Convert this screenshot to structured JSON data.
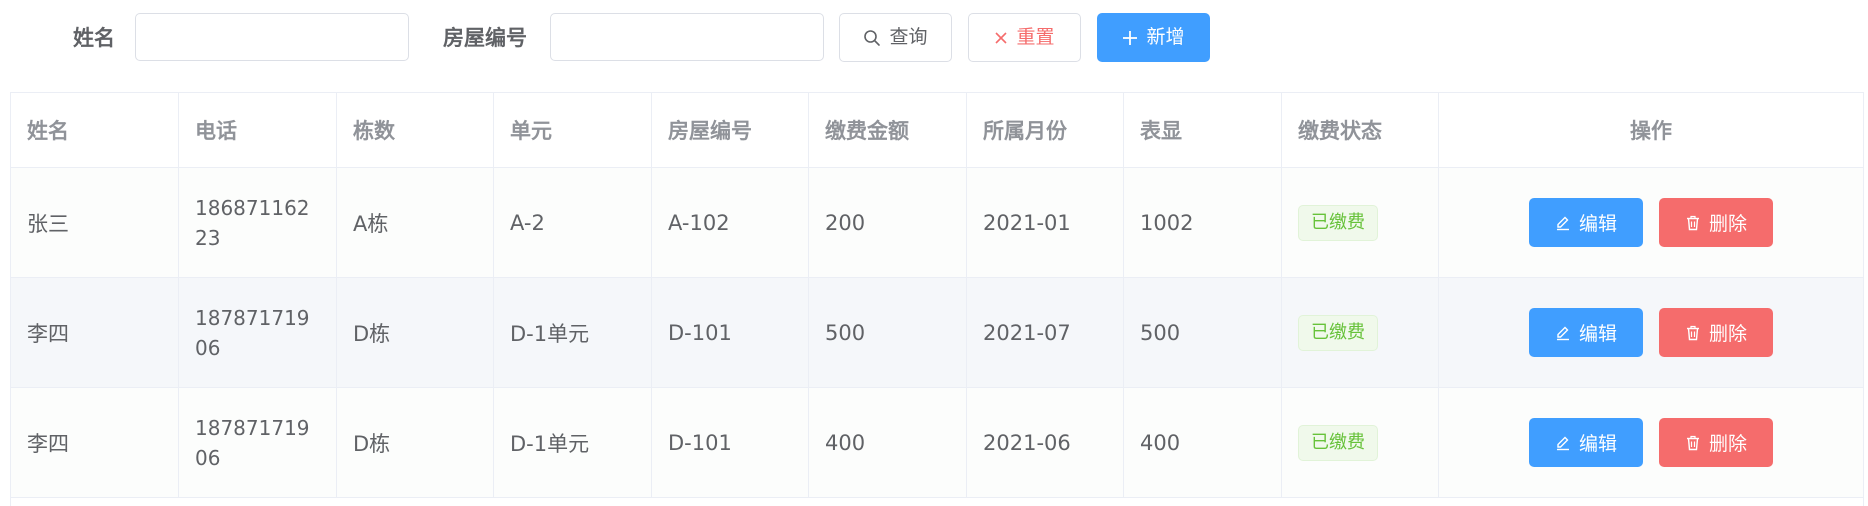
{
  "search": {
    "name_label": "姓名",
    "name_value": "",
    "house_label": "房屋编号",
    "house_value": "",
    "query_label": "查询",
    "reset_label": "重置",
    "add_label": "新增"
  },
  "colors": {
    "primary": "#409eff",
    "danger": "#f56c6c",
    "success": "#67c23a"
  },
  "icons": {
    "query": "search-icon",
    "reset": "close-icon",
    "add": "plus-icon",
    "edit": "edit-icon",
    "delete": "trash-icon"
  },
  "table": {
    "columns": [
      "姓名",
      "电话",
      "栋数",
      "单元",
      "房屋编号",
      "缴费金额",
      "所属月份",
      "表显",
      "缴费状态",
      "操作"
    ],
    "rows": [
      {
        "name": "张三",
        "phone": "18687116223",
        "building": "A栋",
        "unit": "A-2",
        "house": "A-102",
        "amount": "200",
        "month": "2021-01",
        "meter": "1002",
        "status": "已缴费"
      },
      {
        "name": "李四",
        "phone": "18787171906",
        "building": "D栋",
        "unit": "D-1单元",
        "house": "D-101",
        "amount": "500",
        "month": "2021-07",
        "meter": "500",
        "status": "已缴费"
      },
      {
        "name": "李四",
        "phone": "18787171906",
        "building": "D栋",
        "unit": "D-1单元",
        "house": "D-101",
        "amount": "400",
        "month": "2021-06",
        "meter": "400",
        "status": "已缴费"
      }
    ],
    "edit_label": "编辑",
    "delete_label": "删除"
  }
}
